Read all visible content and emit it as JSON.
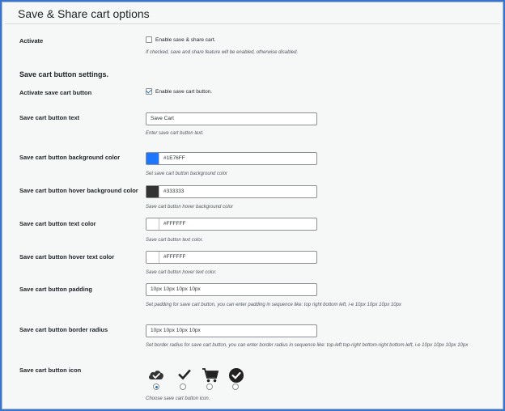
{
  "page": {
    "title": "Save & Share cart options"
  },
  "activate": {
    "label": "Activate",
    "checkbox_label": "Enable save & share cart.",
    "checked": false,
    "description": "If checked, save and share feature will be enabled, otherwise disabled."
  },
  "section": {
    "heading": "Save cart button settings."
  },
  "activate_button": {
    "label": "Activate save cart button",
    "checkbox_label": "Enable save cart button.",
    "checked": true
  },
  "button_text": {
    "label": "Save cart button text",
    "value": "Save Cart",
    "description": "Enter save cart button text."
  },
  "bg_color": {
    "label": "Save cart button background color",
    "value": "#1E76FF",
    "color": "#1E76FF",
    "description": "Set save cart button background color"
  },
  "hover_bg_color": {
    "label": "Save cart button hover background color",
    "value": "#333333",
    "color": "#333333",
    "description": "Save cart button hover background color"
  },
  "text_color": {
    "label": "Save cart button text color",
    "value": "#FFFFFF",
    "color": "#FFFFFF",
    "description": "Save cart button text color."
  },
  "hover_text_color": {
    "label": "Save cart button hover text color",
    "value": "#FFFFFF",
    "color": "#FFFFFF",
    "description": "Save cart button hover text color."
  },
  "padding": {
    "label": "Save cart button padding",
    "value": "10px 10px 10px 10px",
    "description": "Set padding for save cart button, you can enter padding in sequence like: top right bottom left, i-e 10px 10px 10px 10px"
  },
  "border_radius": {
    "label": "Save cart button border radius",
    "value": "10px 10px 10px 10px",
    "description": "Set border radius for save cart button, you can enter border radius in sequence like: top-left top-right bottom-right bottom-left, i-e 10px 10px 10px 10px"
  },
  "button_icon": {
    "label": "Save cart button icon",
    "icons": [
      "cloud-check-icon",
      "checkmark-icon",
      "shopping-cart-icon",
      "check-circle-icon"
    ],
    "selected_index": 0,
    "description": "Choose save cart button icon."
  }
}
